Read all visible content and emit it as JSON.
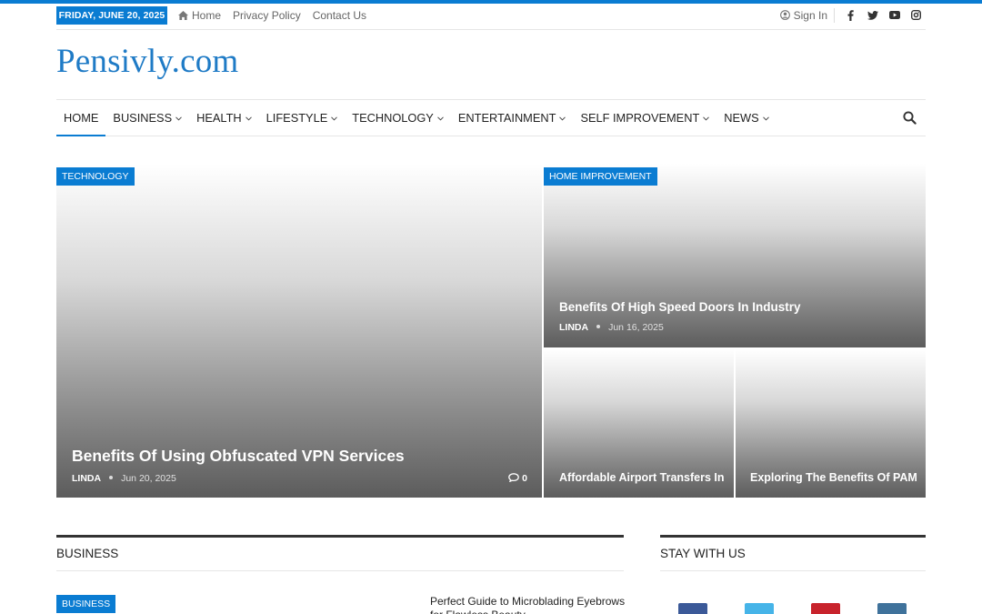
{
  "topbar": {
    "date": "FRIDAY, JUNE 20, 2025",
    "links": [
      "Home",
      "Privacy Policy",
      "Contact Us"
    ],
    "sign_in": "Sign In",
    "socials": [
      "facebook-icon",
      "twitter-icon",
      "youtube-icon",
      "instagram-icon"
    ]
  },
  "site": {
    "logo": "Pensivly.com"
  },
  "nav": {
    "items": [
      {
        "label": "HOME",
        "active": true
      },
      {
        "label": "BUSINESS",
        "dropdown": true
      },
      {
        "label": "HEALTH",
        "dropdown": true
      },
      {
        "label": "LIFESTYLE",
        "dropdown": true
      },
      {
        "label": "TECHNOLOGY",
        "dropdown": true
      },
      {
        "label": "ENTERTAINMENT",
        "dropdown": true
      },
      {
        "label": "SELF IMPROVEMENT",
        "dropdown": true
      },
      {
        "label": "NEWS",
        "dropdown": true
      }
    ]
  },
  "featured": {
    "main": {
      "category": "TECHNOLOGY",
      "title": "Benefits Of Using Obfuscated VPN Services",
      "author": "LINDA",
      "date": "Jun 20, 2025",
      "comments": "0"
    },
    "right_top": {
      "category": "HOME IMPROVEMENT",
      "title": "Benefits Of High Speed Doors In Industry",
      "author": "LINDA",
      "date": "Jun 16, 2025"
    },
    "right_bottom_left": {
      "title": "Affordable Airport Transfers In"
    },
    "right_bottom_right": {
      "title": "Exploring The Benefits Of PAM"
    }
  },
  "sections": {
    "business": {
      "heading": "BUSINESS",
      "badge": "BUSINESS",
      "post_title": "Perfect Guide to Microblading Eyebrows for Flawless Beauty"
    },
    "stay": {
      "heading": "STAY WITH US"
    }
  },
  "colors": {
    "accent": "#0a7cd2",
    "facebook": "#3b5998",
    "twitter": "#46b4e8",
    "pinterest": "#c8232c",
    "instagram": "#3f729b"
  }
}
